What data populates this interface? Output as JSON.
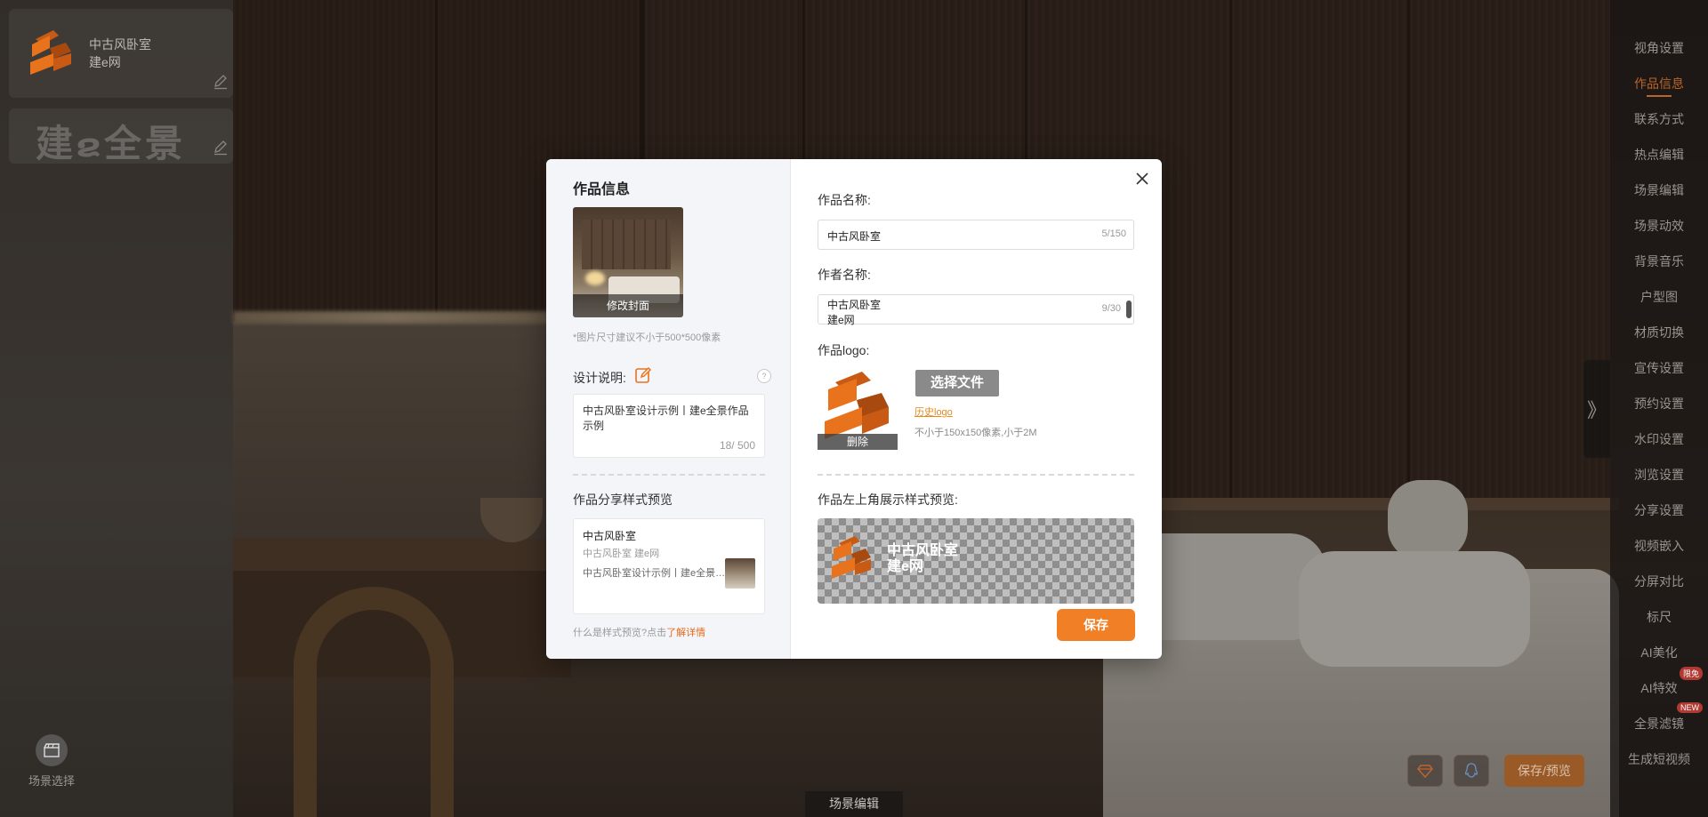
{
  "brand": {
    "title": "中古风卧室",
    "subtitle": "建e网",
    "watermark_text": "建",
    "watermark_text2": "全景"
  },
  "scene_selector": {
    "label": "场景选择",
    "icon": "clapperboard-icon"
  },
  "bottom_tab": {
    "label": "场景编辑"
  },
  "sidebar": {
    "items": [
      {
        "label": "视角设置"
      },
      {
        "label": "作品信息",
        "active": true
      },
      {
        "label": "联系方式"
      },
      {
        "label": "热点编辑"
      },
      {
        "label": "场景编辑"
      },
      {
        "label": "场景动效"
      },
      {
        "label": "背景音乐"
      },
      {
        "label": "户型图"
      },
      {
        "label": "材质切换"
      },
      {
        "label": "宣传设置"
      },
      {
        "label": "预约设置"
      },
      {
        "label": "水印设置"
      },
      {
        "label": "浏览设置"
      },
      {
        "label": "分享设置"
      },
      {
        "label": "视频嵌入"
      },
      {
        "label": "分屏对比"
      },
      {
        "label": "标尺"
      },
      {
        "label": "AI美化"
      },
      {
        "label": "AI特效",
        "badge": "限免"
      },
      {
        "label": "全景滤镜",
        "badge": "NEW"
      },
      {
        "label": "生成短视频"
      }
    ]
  },
  "actions": {
    "save_preview": "保存/预览"
  },
  "modal": {
    "title": "作品信息",
    "cover_button": "修改封面",
    "cover_hint": "*图片尺寸建议不小于500*500像素",
    "design_label": "设计说明:",
    "design_text": "中古风卧室设计示例丨建e全景作品示例",
    "design_count": "18/ 500",
    "help": "?",
    "share_label": "作品分享样式预览",
    "share_card": {
      "title": "中古风卧室",
      "author": "中古风卧室 建e网",
      "desc": "中古风卧室设计示例丨建e全景作品示例"
    },
    "learn_prefix": "什么是样式预览?点击",
    "learn_link": "了解详情",
    "name_label": "作品名称:",
    "name_value": "中古风卧室",
    "name_count": "5/150",
    "author_label": "作者名称:",
    "author_line1": "中古风卧室",
    "author_line2": "建e网",
    "author_count": "9/30",
    "logo_label": "作品logo:",
    "logo_delete": "删除",
    "choose_file": "选择文件",
    "history_logo": "历史logo",
    "logo_hint": "不小于150x150像素,小于2M",
    "preview_label": "作品左上角展示样式预览:",
    "preview_title": "中古风卧室",
    "preview_sub": "建e网",
    "save": "保存"
  },
  "colors": {
    "accent": "#f07f25",
    "active_sidebar": "#b8652a",
    "logo_orange": "#e8731c"
  }
}
